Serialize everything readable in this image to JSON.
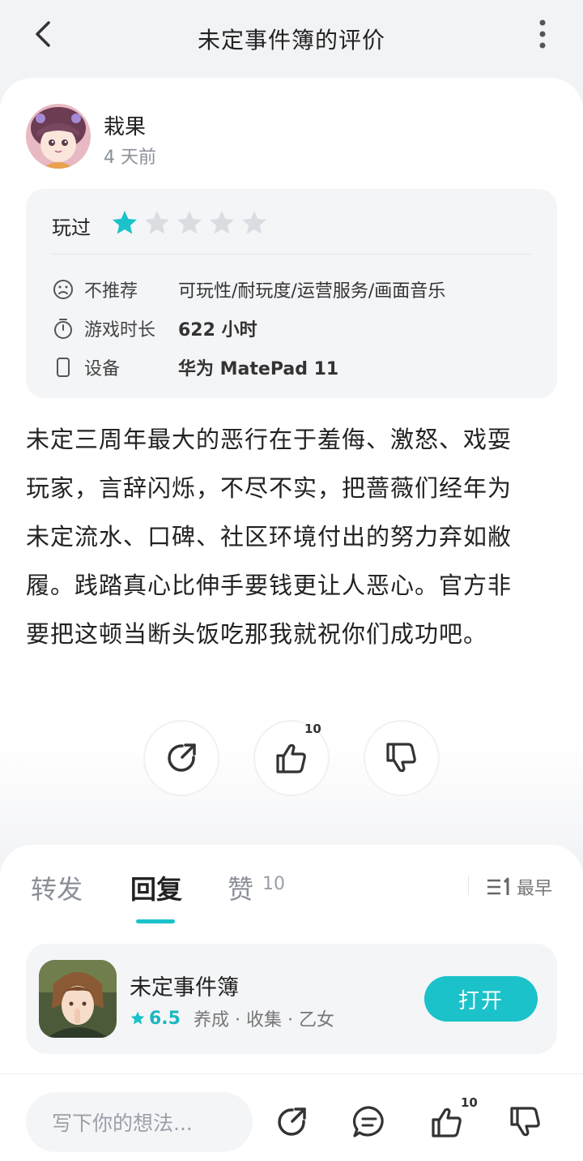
{
  "header": {
    "title": "未定事件簿的评价",
    "back_icon": "chevron-left-icon",
    "more_icon": "more-vertical-icon"
  },
  "review": {
    "author": "栽果",
    "time": "4 天前",
    "status_label": "玩过",
    "rating": 1,
    "rating_max": 5,
    "info": [
      {
        "icon": "frown-icon",
        "label": "不推荐",
        "value": "可玩性/耐玩度/运营服务/画面音乐"
      },
      {
        "icon": "stopwatch-icon",
        "label": "游戏时长",
        "value": "622 小时"
      },
      {
        "icon": "device-icon",
        "label": "设备",
        "value": "华为 MatePad 11"
      }
    ],
    "text_lines": [
      "未定三周年最大的恶行在于羞侮、激怒、戏耍",
      "玩家，言辞闪烁，不尽不实，把蔷薇们经年为",
      "未定流水、口碑、社区环境付出的努力弃如敝",
      "履。践踏真心比伸手要钱更让人恶心。官方非",
      "要把这顿当断头饭吃那我就祝你们成功吧。"
    ]
  },
  "actions": {
    "like_count": "10"
  },
  "tabs": [
    {
      "label": "转发",
      "active": false
    },
    {
      "label": "回复",
      "active": true
    },
    {
      "label": "赞",
      "count": "10",
      "active": false
    }
  ],
  "sort": {
    "label": "最早",
    "icon": "sort-icon"
  },
  "game": {
    "name": "未定事件簿",
    "score": "6.5",
    "tags": "养成 · 收集 · 乙女",
    "open_label": "打开"
  },
  "bottom": {
    "placeholder": "写下你的想法...",
    "like_count": "10"
  },
  "colors": {
    "accent": "#1bc2c9",
    "star_inactive": "#d9dde2"
  }
}
